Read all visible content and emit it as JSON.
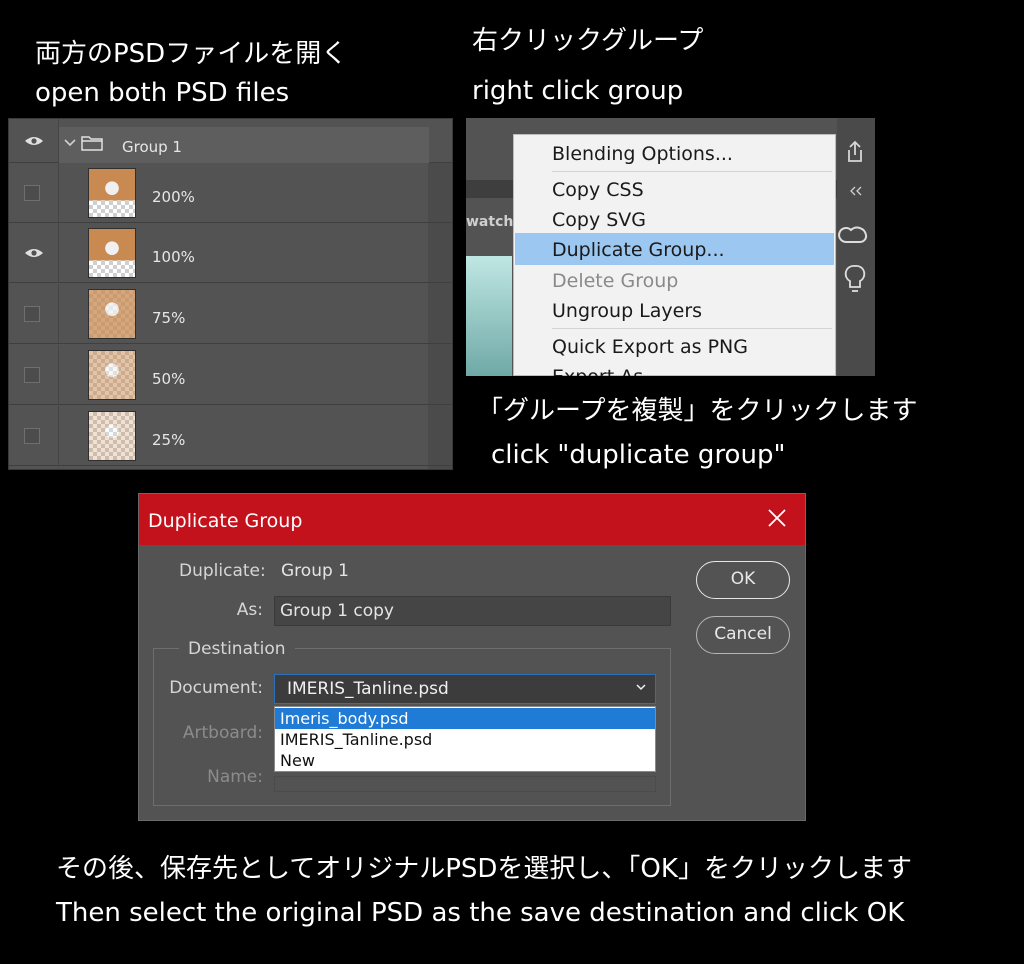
{
  "captions": {
    "step1_jp": "両方のPSDファイルを開く",
    "step1_en": "open both PSD files",
    "step2_jp": "右クリックグループ",
    "step2_en": "right click group",
    "step3_jp": "「グループを複製」をクリックします",
    "step3_en": "click \"duplicate group\"",
    "step4_jp": "その後、保存先としてオリジナルPSDを選択し、「OK」をクリックします",
    "step4_en": "Then select the original PSD as the save destination and click OK"
  },
  "layers_panel": {
    "group_name": "Group 1",
    "layers": [
      {
        "name": "200%",
        "visible": false,
        "opacity": 1.0
      },
      {
        "name": "100%",
        "visible": true,
        "opacity": 1.0
      },
      {
        "name": "75%",
        "visible": false,
        "opacity": 0.75
      },
      {
        "name": "50%",
        "visible": false,
        "opacity": 0.5
      },
      {
        "name": "25%",
        "visible": false,
        "opacity": 0.25
      }
    ]
  },
  "context_menu": {
    "partial_label": "watch",
    "items": [
      {
        "label": "Blending Options...",
        "enabled": true
      },
      {
        "label": "Copy CSS",
        "enabled": true
      },
      {
        "label": "Copy SVG",
        "enabled": true
      },
      {
        "label": "Duplicate Group...",
        "enabled": true,
        "highlighted": true
      },
      {
        "label": "Delete Group",
        "enabled": false
      },
      {
        "label": "Ungroup Layers",
        "enabled": true
      },
      {
        "label": "Quick Export as PNG",
        "enabled": true
      },
      {
        "label": "Export As...",
        "enabled": true
      }
    ]
  },
  "dialog": {
    "title": "Duplicate Group",
    "duplicate_label": "Duplicate:",
    "duplicate_value": "Group 1",
    "as_label": "As:",
    "as_value": "Group 1 copy",
    "destination_legend": "Destination",
    "document_label": "Document:",
    "document_value": "IMERIS_Tanline.psd",
    "document_options": [
      "Imeris_body.psd",
      "IMERIS_Tanline.psd",
      "New"
    ],
    "artboard_label": "Artboard:",
    "name_label": "Name:",
    "ok_label": "OK",
    "cancel_label": "Cancel"
  },
  "colors": {
    "title_bar": "#c3121c",
    "menu_highlight": "#9cc7f0",
    "option_highlight": "#1f7bd6",
    "panel_bg": "#535353"
  }
}
